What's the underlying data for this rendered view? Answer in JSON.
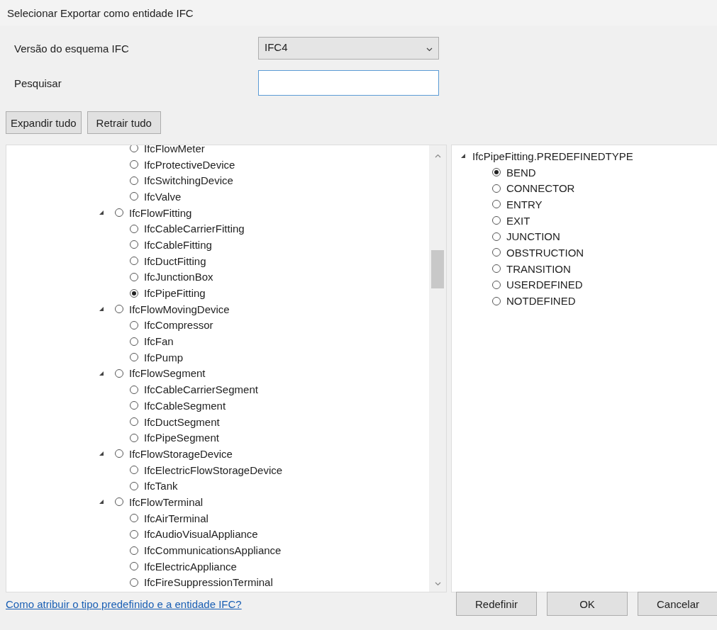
{
  "window": {
    "title": "Selecionar Exportar como entidade IFC"
  },
  "schema": {
    "label": "Versão do esquema IFC",
    "value": "IFC4"
  },
  "search": {
    "label": "Pesquisar"
  },
  "buttons_top": [
    "Expandir tudo",
    "Retrair tudo"
  ],
  "tree": [
    {
      "children": [
        {
          "label": "IfcFlowMeter",
          "selected": false
        },
        {
          "label": "IfcProtectiveDevice",
          "selected": false
        },
        {
          "label": "IfcSwitchingDevice",
          "selected": false
        },
        {
          "label": "IfcValve",
          "selected": false
        }
      ]
    },
    {
      "label": "IfcFlowFitting",
      "selected": false,
      "expanded": true,
      "children": [
        {
          "label": "IfcCableCarrierFitting",
          "selected": false
        },
        {
          "label": "IfcCableFitting",
          "selected": false
        },
        {
          "label": "IfcDuctFitting",
          "selected": false
        },
        {
          "label": "IfcJunctionBox",
          "selected": false
        },
        {
          "label": "IfcPipeFitting",
          "selected": true
        }
      ]
    },
    {
      "label": "IfcFlowMovingDevice",
      "selected": false,
      "expanded": true,
      "children": [
        {
          "label": "IfcCompressor",
          "selected": false
        },
        {
          "label": "IfcFan",
          "selected": false
        },
        {
          "label": "IfcPump",
          "selected": false
        }
      ]
    },
    {
      "label": "IfcFlowSegment",
      "selected": false,
      "expanded": true,
      "children": [
        {
          "label": "IfcCableCarrierSegment",
          "selected": false
        },
        {
          "label": "IfcCableSegment",
          "selected": false
        },
        {
          "label": "IfcDuctSegment",
          "selected": false
        },
        {
          "label": "IfcPipeSegment",
          "selected": false
        }
      ]
    },
    {
      "label": "IfcFlowStorageDevice",
      "selected": false,
      "expanded": true,
      "children": [
        {
          "label": "IfcElectricFlowStorageDevice",
          "selected": false
        },
        {
          "label": "IfcTank",
          "selected": false
        }
      ]
    },
    {
      "label": "IfcFlowTerminal",
      "selected": false,
      "expanded": true,
      "children": [
        {
          "label": "IfcAirTerminal",
          "selected": false
        },
        {
          "label": "IfcAudioVisualAppliance",
          "selected": false
        },
        {
          "label": "IfcCommunicationsAppliance",
          "selected": false
        },
        {
          "label": "IfcElectricAppliance",
          "selected": false
        },
        {
          "label": "IfcFireSuppressionTerminal",
          "selected": false
        }
      ]
    }
  ],
  "types": {
    "label": "IfcPipeFitting.PREDEFINEDTYPE",
    "expanded": true,
    "children": [
      {
        "label": "BEND",
        "selected": true
      },
      {
        "label": "CONNECTOR",
        "selected": false
      },
      {
        "label": "ENTRY",
        "selected": false
      },
      {
        "label": "EXIT",
        "selected": false
      },
      {
        "label": "JUNCTION",
        "selected": false
      },
      {
        "label": "OBSTRUCTION",
        "selected": false
      },
      {
        "label": "TRANSITION",
        "selected": false
      },
      {
        "label": "USERDEFINED",
        "selected": false
      },
      {
        "label": "NOTDEFINED",
        "selected": false
      }
    ]
  },
  "help_link": "Como atribuir o tipo predefinido e a entidade IFC?",
  "buttons_bottom": [
    "Redefinir",
    "OK",
    "Cancelar"
  ]
}
